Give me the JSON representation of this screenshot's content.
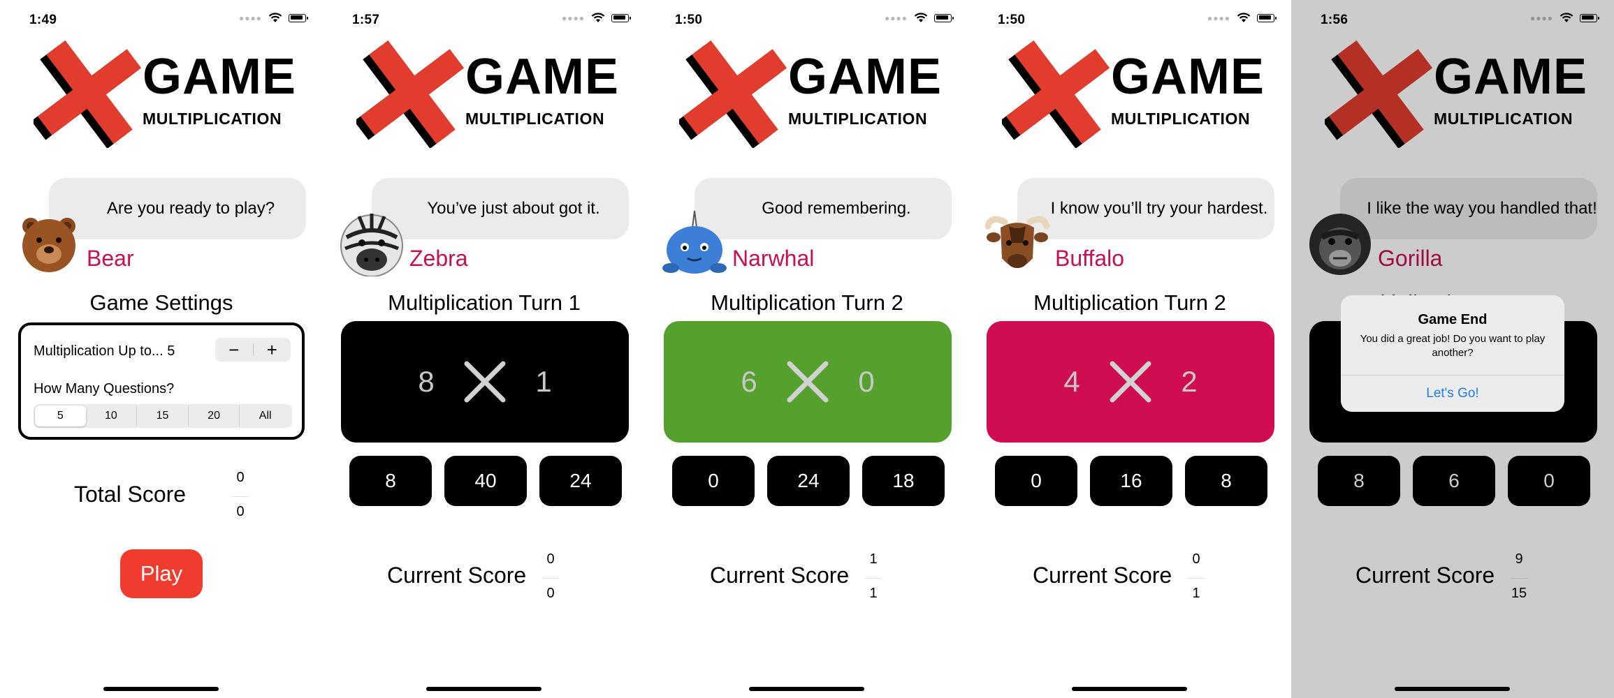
{
  "logo": {
    "game": "GAME",
    "subtitle": "MULTIPLICATION"
  },
  "colors": {
    "accent_pink": "#c90d56",
    "play_red": "#f23b2f",
    "cross_red": "#e23c2f",
    "correct_green": "#56a12e",
    "wrong_pink": "#d00c52",
    "link_blue": "#1d7ef0"
  },
  "screens": [
    {
      "time": "1:49",
      "message": "Are you ready to play?",
      "animal": "Bear",
      "animal_icon": "bear-icon",
      "title": "Game Settings",
      "settings": {
        "up_to_label": "Multiplication Up to... 5",
        "minus": "−",
        "plus": "+",
        "questions_label": "How Many Questions?",
        "options": [
          "5",
          "10",
          "15",
          "20",
          "All"
        ],
        "selected": "5"
      },
      "score_label": "Total Score",
      "score_top": "0",
      "score_bottom": "0",
      "play_label": "Play"
    },
    {
      "time": "1:57",
      "message": "You’ve just about got it.",
      "animal": "Zebra",
      "animal_icon": "zebra-icon",
      "title": "Multiplication Turn 1",
      "problem": {
        "a": "8",
        "b": "1",
        "state": "neutral"
      },
      "answers": [
        "8",
        "40",
        "24"
      ],
      "score_label": "Current Score",
      "score_top": "0",
      "score_bottom": "0"
    },
    {
      "time": "1:50",
      "message": "Good remembering.",
      "animal": "Narwhal",
      "animal_icon": "narwhal-icon",
      "title": "Multiplication Turn 2",
      "problem": {
        "a": "6",
        "b": "0",
        "state": "correct"
      },
      "answers": [
        "0",
        "24",
        "18"
      ],
      "score_label": "Current Score",
      "score_top": "1",
      "score_bottom": "1"
    },
    {
      "time": "1:50",
      "message": "I know you’ll try your hardest.",
      "animal": "Buffalo",
      "animal_icon": "buffalo-icon",
      "title": "Multiplication Turn 2",
      "problem": {
        "a": "4",
        "b": "2",
        "state": "wrong"
      },
      "answers": [
        "0",
        "16",
        "8"
      ],
      "score_label": "Current Score",
      "score_top": "0",
      "score_bottom": "1"
    },
    {
      "time": "1:56",
      "message": "I like the way you handled that!",
      "animal": "Gorilla",
      "animal_icon": "gorilla-icon",
      "title": "Multiplication Turn 15",
      "problem": {
        "a": "",
        "b": "",
        "state": "neutral"
      },
      "answers": [
        "8",
        "6",
        "0"
      ],
      "score_label": "Current Score",
      "score_top": "9",
      "score_bottom": "15",
      "alert": {
        "title": "Game End",
        "message": "You did a great job! Do you want to play another?",
        "button": "Let's Go!"
      }
    }
  ]
}
